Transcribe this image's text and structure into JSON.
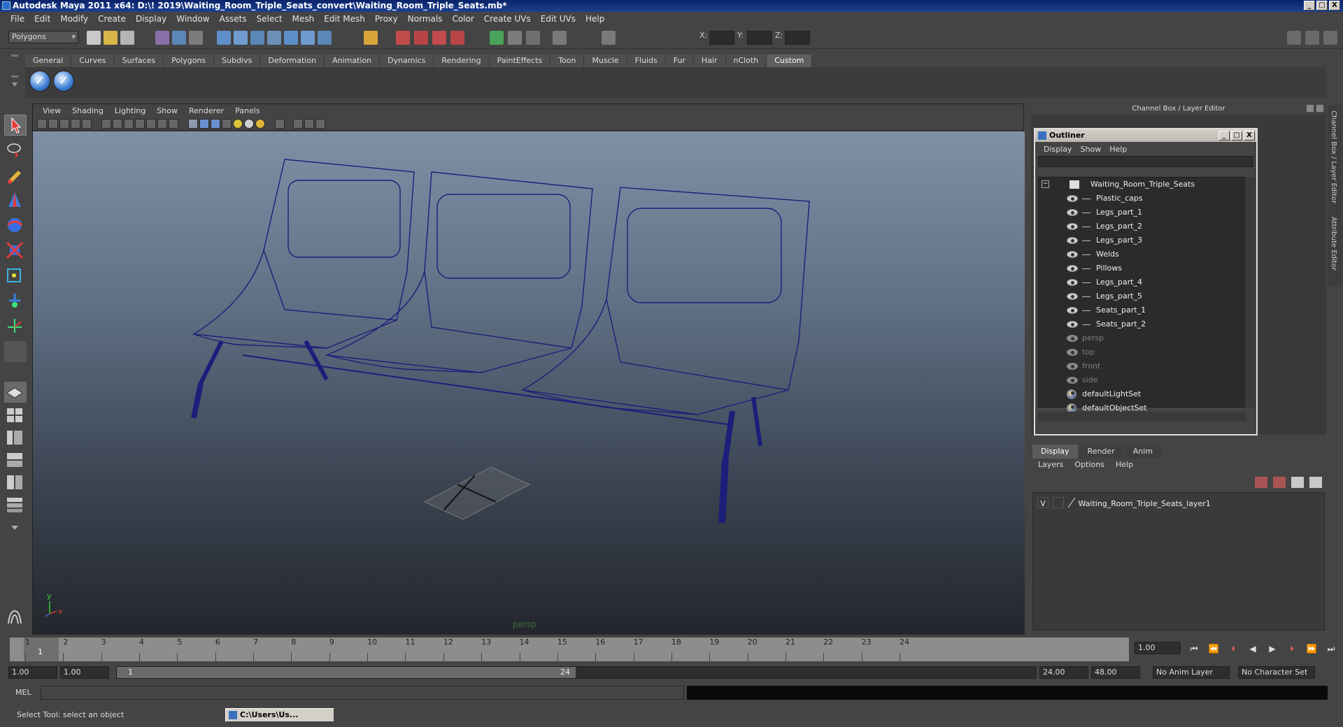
{
  "window": {
    "title": "Autodesk Maya 2011 x64: D:\\! 2019\\Waiting_Room_Triple_Seats_convert\\Waiting_Room_Triple_Seats.mb*",
    "buttons": [
      "_",
      "□",
      "X"
    ]
  },
  "menubar": [
    "File",
    "Edit",
    "Modify",
    "Create",
    "Display",
    "Window",
    "Assets",
    "Select",
    "Mesh",
    "Edit Mesh",
    "Proxy",
    "Normals",
    "Color",
    "Create UVs",
    "Edit UVs",
    "Help"
  ],
  "statusline": {
    "mode": "Polygons",
    "x_label": "X:",
    "y_label": "Y:",
    "z_label": "Z:"
  },
  "shelf": {
    "tabs": [
      "General",
      "Curves",
      "Surfaces",
      "Polygons",
      "Subdivs",
      "Deformation",
      "Animation",
      "Dynamics",
      "Rendering",
      "PaintEffects",
      "Toon",
      "Muscle",
      "Fluids",
      "Fur",
      "Hair",
      "nCloth",
      "Custom"
    ],
    "active_tab": "Custom",
    "buttons": [
      "✓",
      "✓"
    ]
  },
  "viewport": {
    "menus": [
      "View",
      "Shading",
      "Lighting",
      "Show",
      "Renderer",
      "Panels"
    ],
    "camera_label": "persp",
    "axis_y": "y",
    "axis_x": "x"
  },
  "channelbox": {
    "title": "Channel Box / Layer Editor",
    "side_tabs": [
      "Channel Box / Layer Editor",
      "Attribute Editor"
    ]
  },
  "outliner": {
    "title": "Outliner",
    "menus": [
      "Display",
      "Show",
      "Help"
    ],
    "root": "Waiting_Room_Triple_Seats",
    "children": [
      "Plastic_caps",
      "Legs_part_1",
      "Legs_part_2",
      "Legs_part_3",
      "Welds",
      "Pillows",
      "Legs_part_4",
      "Legs_part_5",
      "Seats_part_1",
      "Seats_part_2"
    ],
    "cameras": [
      "persp",
      "top",
      "front",
      "side"
    ],
    "sets": [
      "defaultLightSet",
      "defaultObjectSet"
    ]
  },
  "layer_editor": {
    "tabs": [
      "Display",
      "Render",
      "Anim"
    ],
    "active_tab": "Display",
    "menus": [
      "Layers",
      "Options",
      "Help"
    ],
    "layer": {
      "visibility": "V",
      "name": "Waiting_Room_Triple_Seats_layer1"
    }
  },
  "timeline": {
    "ticks": [
      "1",
      "2",
      "3",
      "4",
      "5",
      "6",
      "7",
      "8",
      "9",
      "10",
      "11",
      "12",
      "13",
      "14",
      "15",
      "16",
      "17",
      "18",
      "19",
      "20",
      "21",
      "22",
      "23",
      "24"
    ],
    "current_marker": "1",
    "current_frame": "1.00"
  },
  "range": {
    "start": "1.00",
    "playback_start": "1.00",
    "slider_start": "1",
    "slider_end": "24",
    "playback_end": "24.00",
    "end": "48.00",
    "anim_layer": "No Anim Layer",
    "character_set": "No Character Set"
  },
  "command": {
    "label": "MEL"
  },
  "helpline": {
    "text": "Select Tool: select an object",
    "task_item": "C:\\Users\\Us..."
  }
}
